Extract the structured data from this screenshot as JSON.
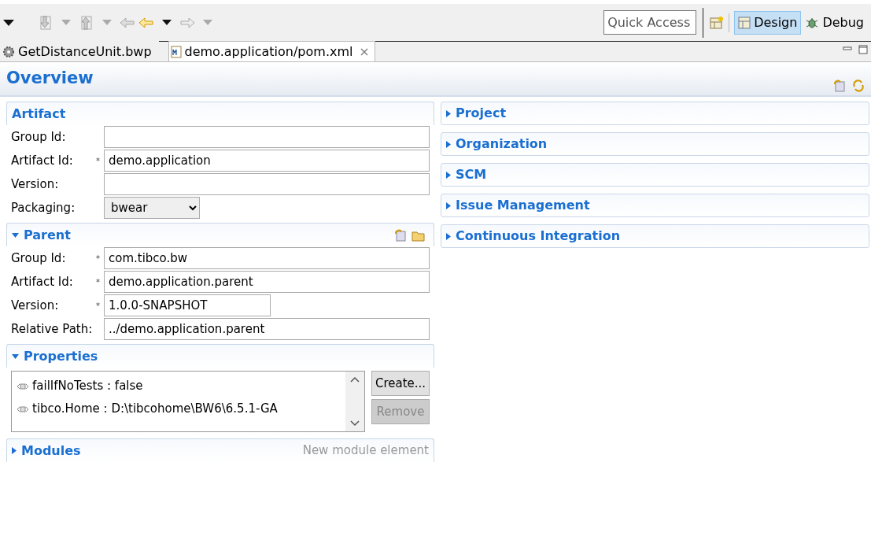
{
  "toolbar": {
    "quick_access": {
      "placeholder": "Quick Access"
    },
    "perspectives": [
      {
        "label": "Design",
        "selected": true,
        "kind": "design"
      },
      {
        "label": "Debug",
        "selected": false,
        "kind": "debug"
      }
    ]
  },
  "tabs": [
    {
      "label": "GetDistanceUnit.bwp",
      "selected": false,
      "kind": "process",
      "closable": false
    },
    {
      "label": "demo.application/pom.xml",
      "selected": true,
      "kind": "pom",
      "closable": true
    }
  ],
  "page_title": "Overview",
  "left_sections": [
    {
      "title": "Artifact",
      "kind": "fields",
      "fields": [
        {
          "label": "Group Id:",
          "kind": "text"
        },
        {
          "label": "Artifact Id:",
          "marker": "*",
          "value": "demo.application",
          "kind": "text"
        },
        {
          "label": "Version:",
          "kind": "text"
        },
        {
          "label": "Packaging:",
          "value": "bwear",
          "kind": "select"
        }
      ]
    },
    {
      "title": "Parent",
      "kind": "fields",
      "expanded": true,
      "tools": true,
      "fields": [
        {
          "label": "Group Id:",
          "marker": "*",
          "value": "com.tibco.bw",
          "kind": "text"
        },
        {
          "label": "Artifact Id:",
          "marker": "*",
          "value": "demo.application.parent",
          "kind": "text"
        },
        {
          "label": "Version:",
          "marker": "*",
          "value": "1.0.0-SNAPSHOT",
          "kind": "short"
        },
        {
          "label": "Relative Path:",
          "value": "../demo.application.parent",
          "kind": "text"
        }
      ]
    },
    {
      "title": "Properties",
      "kind": "list",
      "expanded": true,
      "items": [
        "failIfNoTests : false",
        "tibco.Home : D:\\tibcohome\\BW6\\6.5.1-GA"
      ],
      "buttons": [
        {
          "label": "Create...",
          "disabled": false
        },
        {
          "label": "Remove",
          "disabled": true
        }
      ]
    },
    {
      "title": "Modules",
      "kind": "hint",
      "expanded": false,
      "hint": "New module element"
    }
  ],
  "right_sections": [
    {
      "title": "Project",
      "expanded": false
    },
    {
      "title": "Organization",
      "expanded": false
    },
    {
      "title": "SCM",
      "expanded": false
    },
    {
      "title": "Issue Management",
      "expanded": false
    },
    {
      "title": "Continuous Integration",
      "expanded": false
    }
  ]
}
